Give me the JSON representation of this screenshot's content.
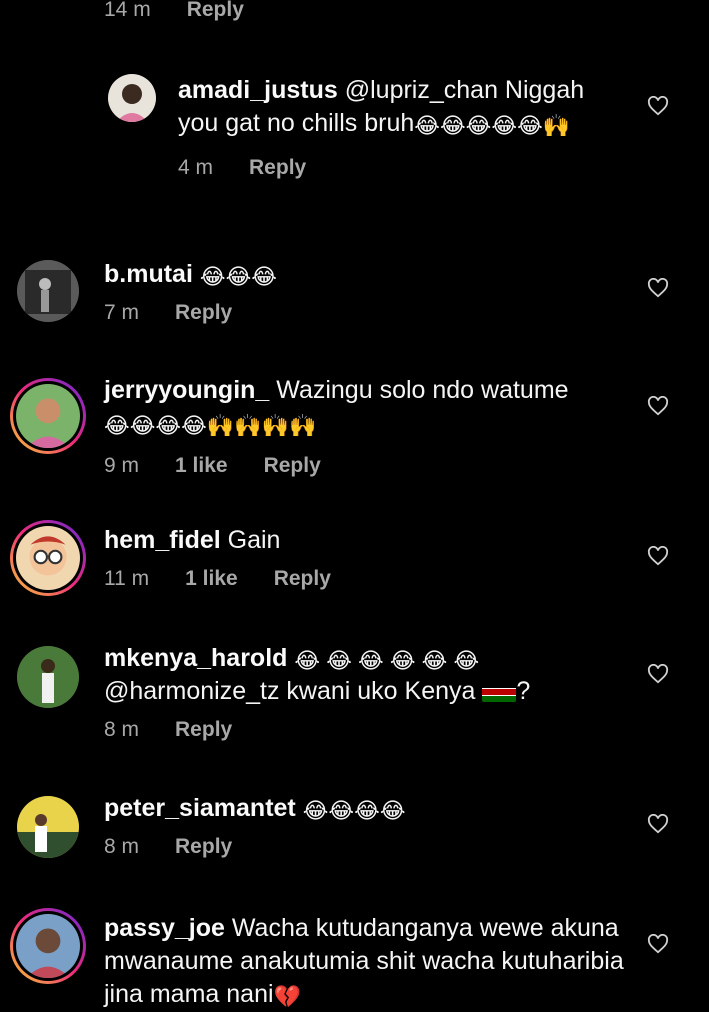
{
  "top": {
    "time": "14 m",
    "reply": "Reply"
  },
  "comments": [
    {
      "username": "amadi_justus",
      "text": "@lupriz_chan Niggah you gat no chills bruh",
      "emojis": "😂😂😂😂😂🙌",
      "time": "4 m",
      "likes": "",
      "reply": "Reply"
    },
    {
      "username": "b.mutai",
      "text": "",
      "emojis": "😂😂😂",
      "time": "7 m",
      "likes": "",
      "reply": "Reply"
    },
    {
      "username": "jerryyoungin_",
      "text": "Wazingu solo ndo watume",
      "emojis": "😂😂😂😂🙌🙌🙌🙌",
      "time": "9 m",
      "likes": "1 like",
      "reply": "Reply"
    },
    {
      "username": "hem_fidel",
      "text": "Gain",
      "emojis": "",
      "time": "11 m",
      "likes": "1 like",
      "reply": "Reply"
    },
    {
      "username": "mkenya_harold",
      "emojis": "😂 😂 😂 😂 😂 😂",
      "text": "@harmonize_tz kwani uko Kenya",
      "text_suffix": "?",
      "time": "8 m",
      "likes": "",
      "reply": "Reply"
    },
    {
      "username": "peter_siamantet",
      "text": "",
      "emojis": "😂😂😂😂",
      "time": "8 m",
      "likes": "",
      "reply": "Reply"
    },
    {
      "username": "passy_joe",
      "text": "Wacha kutudanganya wewe akuna mwanaume anakutumia shit  wacha kutuharibia jina mama nani",
      "emojis": "💔",
      "time": "",
      "likes": "",
      "reply": ""
    }
  ],
  "icons": {
    "heart": "heart-outline-icon",
    "flag": "kenya-flag-emoji"
  },
  "colors": {
    "background": "#000000",
    "text": "#f5f5f5",
    "meta": "#a8a8a8"
  }
}
